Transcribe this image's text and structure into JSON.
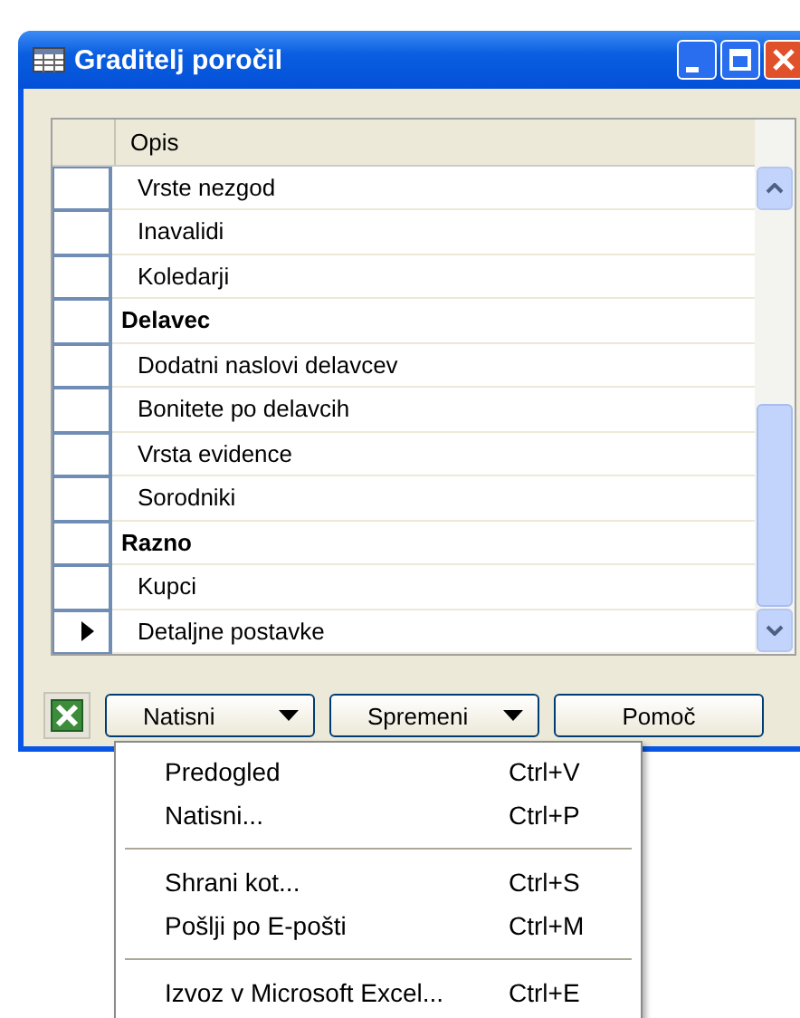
{
  "window": {
    "title": "Graditelj poročil"
  },
  "table": {
    "columns": [
      "Opis"
    ],
    "rows": [
      {
        "text": "Vrste nezgod",
        "kind": "item",
        "current": false
      },
      {
        "text": "Inavalidi",
        "kind": "item",
        "current": false
      },
      {
        "text": "Koledarji",
        "kind": "item",
        "current": false
      },
      {
        "text": "Delavec",
        "kind": "group",
        "current": false
      },
      {
        "text": "Dodatni naslovi delavcev",
        "kind": "item",
        "current": false
      },
      {
        "text": "Bonitete po delavcih",
        "kind": "item",
        "current": false
      },
      {
        "text": "Vrsta evidence",
        "kind": "item",
        "current": false
      },
      {
        "text": "Sorodniki",
        "kind": "item",
        "current": false
      },
      {
        "text": "Razno",
        "kind": "group",
        "current": false
      },
      {
        "text": "Kupci",
        "kind": "item",
        "current": false
      },
      {
        "text": "Detaljne postavke",
        "kind": "item",
        "current": true
      }
    ]
  },
  "buttons": [
    {
      "label": "Natisni",
      "dropdown": true
    },
    {
      "label": "Spremeni",
      "dropdown": true
    },
    {
      "label": "Pomoč",
      "dropdown": false
    }
  ],
  "menu": {
    "items": [
      {
        "kind": "item",
        "label": "Predogled",
        "shortcut": "Ctrl+V"
      },
      {
        "kind": "item",
        "label": "Natisni...",
        "shortcut": "Ctrl+P"
      },
      {
        "kind": "separator"
      },
      {
        "kind": "item",
        "label": "Shrani kot...",
        "shortcut": "Ctrl+S"
      },
      {
        "kind": "item",
        "label": "Pošlji po E-pošti",
        "shortcut": "Ctrl+M"
      },
      {
        "kind": "separator"
      },
      {
        "kind": "item",
        "label": "Izvoz v Microsoft Excel...",
        "shortcut": "Ctrl+E"
      }
    ]
  }
}
